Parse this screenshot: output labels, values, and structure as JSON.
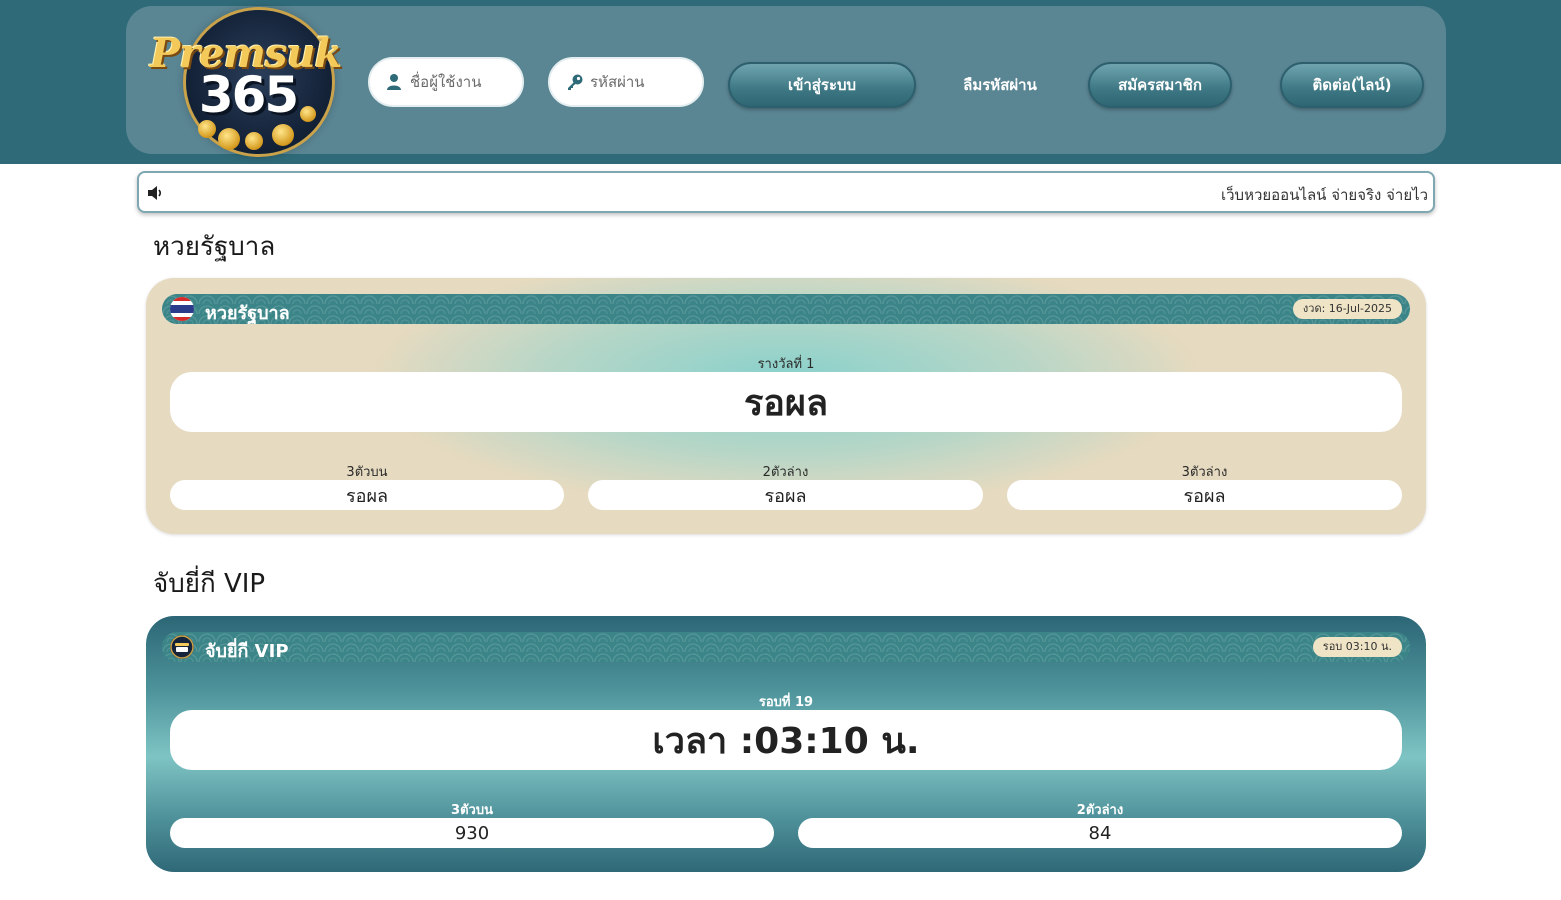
{
  "header": {
    "logo_line1": "Premsuk",
    "logo_line2": "365",
    "username_placeholder": "ชื่อผู้ใช้งาน",
    "password_placeholder": "รหัสผ่าน",
    "login_label": "เข้าสู่ระบบ",
    "forgot_label": "ลืมรหัสผ่าน",
    "register_label": "สมัครสมาชิก",
    "contact_label": "ติดต่อ(ไลน์)",
    "icons": {
      "user": "user-icon",
      "password": "key-icon"
    }
  },
  "marquee": {
    "icon": "speaker-icon",
    "text": "เว็บหวยออนไลน์ จ่ายจริง จ่ายไว เ"
  },
  "government": {
    "section_title": "หวยรัฐบาล",
    "card_title": "หวยรัฐบาล",
    "icon": "thai-flag-icon",
    "date_badge": "งวด: 16-Jul-2025",
    "first_prize_label": "รางวัลที่ 1",
    "first_prize_value": "รอผล",
    "sub_results": [
      {
        "label": "3ตัวบน",
        "value": "รอผล"
      },
      {
        "label": "2ตัวล่าง",
        "value": "รอผล"
      },
      {
        "label": "3ตัวล่าง",
        "value": "รอผล"
      }
    ]
  },
  "vip": {
    "section_title": "จับยี่กี VIP",
    "card_title": "จับยี่กี VIP",
    "icon": "premsuk-logo-icon",
    "round_badge": "รอบ 03:10 น.",
    "round_label": "รอบที่ 19",
    "time_value": "เวลา :03:10 น.",
    "sub_results": [
      {
        "label": "3ตัวบน",
        "value": "930"
      },
      {
        "label": "2ตัวล่าง",
        "value": "84"
      }
    ]
  },
  "colors": {
    "topbar": "#2f6a79",
    "header_panel": "#5a8593",
    "accent": "#3b8588",
    "gold": "#f3c95a"
  }
}
